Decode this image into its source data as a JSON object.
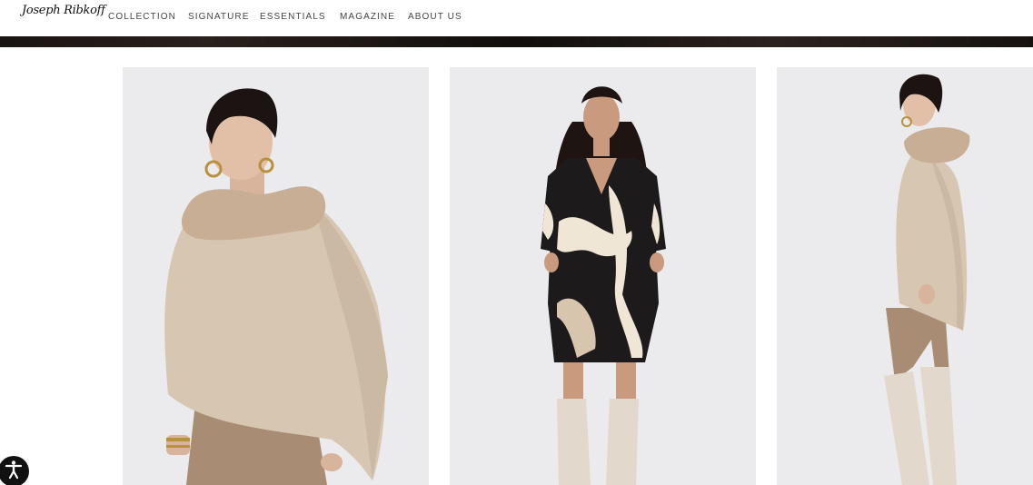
{
  "header": {
    "logo_text": "Joseph Ribkoff",
    "nav": [
      {
        "label": "COLLECTION"
      },
      {
        "label": "SIGNATURE"
      },
      {
        "label": "ESSENTIALS"
      },
      {
        "label": "MAGAZINE"
      },
      {
        "label": "ABOUT US"
      }
    ]
  },
  "products": [
    {
      "image": "model-in-beige-poncho-with-faux-fur-collar"
    },
    {
      "image": "model-in-black-printed-v-neck-dress-with-cream-boots"
    },
    {
      "image": "model-in-beige-poncho-side-view-with-cream-boots"
    }
  ],
  "accessibility_button": {
    "icon": "accessibility-icon"
  },
  "colors": {
    "nav_text": "#444444",
    "band": "#1a1412",
    "image_bg": "#ebeaec",
    "beige": "#d6c6b2",
    "fur": "#c9ae96",
    "pants": "#a88d74",
    "boots": "#e2d8cb",
    "dress_dark": "#1d1a1c",
    "dress_light": "#efe6d6"
  }
}
